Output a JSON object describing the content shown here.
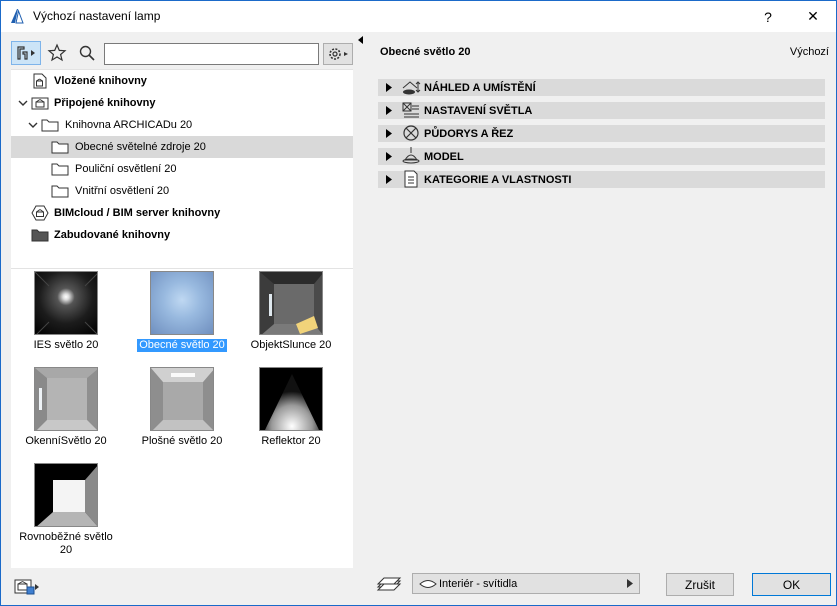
{
  "window": {
    "title": "Výchozí nastavení lamp",
    "help_label": "?",
    "close_label": "✕"
  },
  "left": {
    "search": {
      "value": "",
      "placeholder": ""
    },
    "tree": [
      {
        "label": "Vložené knihovny",
        "bold": true,
        "icon": "embedded-library-icon",
        "arrow": ""
      },
      {
        "label": "Připojené knihovny",
        "bold": true,
        "icon": "linked-library-icon",
        "arrow": "v"
      },
      {
        "label": "Knihovna ARCHICADu 20",
        "bold": false,
        "icon": "folder-icon",
        "arrow": "v"
      },
      {
        "label": "Obecné světelné zdroje 20",
        "bold": false,
        "icon": "folder-icon",
        "arrow": "",
        "selected": true
      },
      {
        "label": "Pouliční osvětlení 20",
        "bold": false,
        "icon": "folder-icon",
        "arrow": ""
      },
      {
        "label": "Vnitřní osvětlení 20",
        "bold": false,
        "icon": "folder-icon",
        "arrow": ""
      },
      {
        "label": "BIMcloud / BIM server knihovny",
        "bold": true,
        "icon": "bimcloud-icon",
        "arrow": ""
      },
      {
        "label": "Zabudované knihovny",
        "bold": true,
        "icon": "built-in-folder-icon",
        "arrow": ""
      }
    ],
    "items": [
      {
        "label": "IES světlo 20",
        "selected": false
      },
      {
        "label": "Obecné světlo 20",
        "selected": true
      },
      {
        "label": "ObjektSlunce 20",
        "selected": false
      },
      {
        "label": "OkenníSvětlo 20",
        "selected": false
      },
      {
        "label": "Plošné světlo 20",
        "selected": false
      },
      {
        "label": "Reflektor 20",
        "selected": false
      },
      {
        "label": "Rovnoběžné světlo 20",
        "selected": false
      }
    ]
  },
  "right": {
    "object_name": "Obecné světlo 20",
    "default_label": "Výchozí",
    "panels": [
      {
        "title": "NÁHLED A UMÍSTĚNÍ",
        "icon": "preview-position-icon"
      },
      {
        "title": "NASTAVENÍ SVĚTLA",
        "icon": "light-settings-icon"
      },
      {
        "title": "PŮDORYS A ŘEZ",
        "icon": "floorplan-section-icon"
      },
      {
        "title": "MODEL",
        "icon": "lamp-model-icon"
      },
      {
        "title": "KATEGORIE A VLASTNOSTI",
        "icon": "categories-properties-icon"
      }
    ],
    "footer": {
      "layer_value": "Interiér - svítidla",
      "cancel_label": "Zrušit",
      "ok_label": "OK"
    }
  }
}
